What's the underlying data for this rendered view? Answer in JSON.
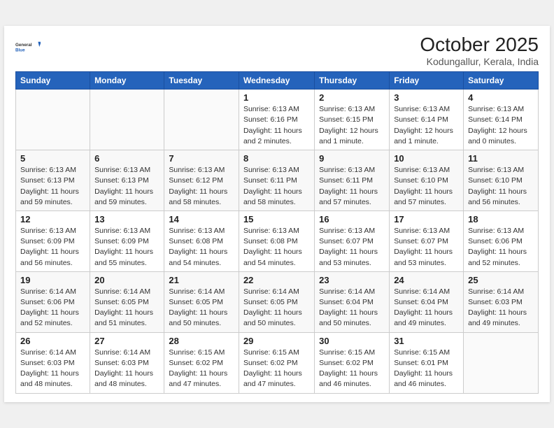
{
  "logo": {
    "general": "General",
    "blue": "Blue"
  },
  "title": "October 2025",
  "subtitle": "Kodungallur, Kerala, India",
  "weekdays": [
    "Sunday",
    "Monday",
    "Tuesday",
    "Wednesday",
    "Thursday",
    "Friday",
    "Saturday"
  ],
  "weeks": [
    [
      {
        "day": "",
        "info": ""
      },
      {
        "day": "",
        "info": ""
      },
      {
        "day": "",
        "info": ""
      },
      {
        "day": "1",
        "info": "Sunrise: 6:13 AM\nSunset: 6:16 PM\nDaylight: 11 hours\nand 2 minutes."
      },
      {
        "day": "2",
        "info": "Sunrise: 6:13 AM\nSunset: 6:15 PM\nDaylight: 12 hours\nand 1 minute."
      },
      {
        "day": "3",
        "info": "Sunrise: 6:13 AM\nSunset: 6:14 PM\nDaylight: 12 hours\nand 1 minute."
      },
      {
        "day": "4",
        "info": "Sunrise: 6:13 AM\nSunset: 6:14 PM\nDaylight: 12 hours\nand 0 minutes."
      }
    ],
    [
      {
        "day": "5",
        "info": "Sunrise: 6:13 AM\nSunset: 6:13 PM\nDaylight: 11 hours\nand 59 minutes."
      },
      {
        "day": "6",
        "info": "Sunrise: 6:13 AM\nSunset: 6:13 PM\nDaylight: 11 hours\nand 59 minutes."
      },
      {
        "day": "7",
        "info": "Sunrise: 6:13 AM\nSunset: 6:12 PM\nDaylight: 11 hours\nand 58 minutes."
      },
      {
        "day": "8",
        "info": "Sunrise: 6:13 AM\nSunset: 6:11 PM\nDaylight: 11 hours\nand 58 minutes."
      },
      {
        "day": "9",
        "info": "Sunrise: 6:13 AM\nSunset: 6:11 PM\nDaylight: 11 hours\nand 57 minutes."
      },
      {
        "day": "10",
        "info": "Sunrise: 6:13 AM\nSunset: 6:10 PM\nDaylight: 11 hours\nand 57 minutes."
      },
      {
        "day": "11",
        "info": "Sunrise: 6:13 AM\nSunset: 6:10 PM\nDaylight: 11 hours\nand 56 minutes."
      }
    ],
    [
      {
        "day": "12",
        "info": "Sunrise: 6:13 AM\nSunset: 6:09 PM\nDaylight: 11 hours\nand 56 minutes."
      },
      {
        "day": "13",
        "info": "Sunrise: 6:13 AM\nSunset: 6:09 PM\nDaylight: 11 hours\nand 55 minutes."
      },
      {
        "day": "14",
        "info": "Sunrise: 6:13 AM\nSunset: 6:08 PM\nDaylight: 11 hours\nand 54 minutes."
      },
      {
        "day": "15",
        "info": "Sunrise: 6:13 AM\nSunset: 6:08 PM\nDaylight: 11 hours\nand 54 minutes."
      },
      {
        "day": "16",
        "info": "Sunrise: 6:13 AM\nSunset: 6:07 PM\nDaylight: 11 hours\nand 53 minutes."
      },
      {
        "day": "17",
        "info": "Sunrise: 6:13 AM\nSunset: 6:07 PM\nDaylight: 11 hours\nand 53 minutes."
      },
      {
        "day": "18",
        "info": "Sunrise: 6:13 AM\nSunset: 6:06 PM\nDaylight: 11 hours\nand 52 minutes."
      }
    ],
    [
      {
        "day": "19",
        "info": "Sunrise: 6:14 AM\nSunset: 6:06 PM\nDaylight: 11 hours\nand 52 minutes."
      },
      {
        "day": "20",
        "info": "Sunrise: 6:14 AM\nSunset: 6:05 PM\nDaylight: 11 hours\nand 51 minutes."
      },
      {
        "day": "21",
        "info": "Sunrise: 6:14 AM\nSunset: 6:05 PM\nDaylight: 11 hours\nand 50 minutes."
      },
      {
        "day": "22",
        "info": "Sunrise: 6:14 AM\nSunset: 6:05 PM\nDaylight: 11 hours\nand 50 minutes."
      },
      {
        "day": "23",
        "info": "Sunrise: 6:14 AM\nSunset: 6:04 PM\nDaylight: 11 hours\nand 50 minutes."
      },
      {
        "day": "24",
        "info": "Sunrise: 6:14 AM\nSunset: 6:04 PM\nDaylight: 11 hours\nand 49 minutes."
      },
      {
        "day": "25",
        "info": "Sunrise: 6:14 AM\nSunset: 6:03 PM\nDaylight: 11 hours\nand 49 minutes."
      }
    ],
    [
      {
        "day": "26",
        "info": "Sunrise: 6:14 AM\nSunset: 6:03 PM\nDaylight: 11 hours\nand 48 minutes."
      },
      {
        "day": "27",
        "info": "Sunrise: 6:14 AM\nSunset: 6:03 PM\nDaylight: 11 hours\nand 48 minutes."
      },
      {
        "day": "28",
        "info": "Sunrise: 6:15 AM\nSunset: 6:02 PM\nDaylight: 11 hours\nand 47 minutes."
      },
      {
        "day": "29",
        "info": "Sunrise: 6:15 AM\nSunset: 6:02 PM\nDaylight: 11 hours\nand 47 minutes."
      },
      {
        "day": "30",
        "info": "Sunrise: 6:15 AM\nSunset: 6:02 PM\nDaylight: 11 hours\nand 46 minutes."
      },
      {
        "day": "31",
        "info": "Sunrise: 6:15 AM\nSunset: 6:01 PM\nDaylight: 11 hours\nand 46 minutes."
      },
      {
        "day": "",
        "info": ""
      }
    ]
  ]
}
